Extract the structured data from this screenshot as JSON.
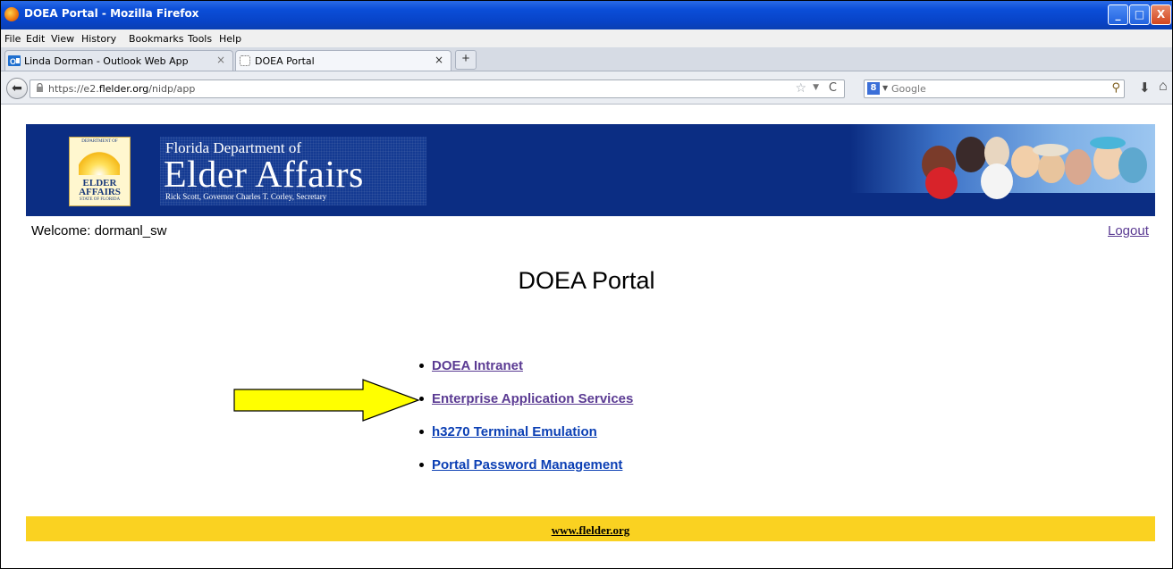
{
  "window": {
    "title": "DOEA Portal - Mozilla Firefox",
    "minimize": "_",
    "maximize": "□",
    "close": "X"
  },
  "menu": [
    "File",
    "Edit",
    "View",
    "History",
    "Bookmarks",
    "Tools",
    "Help"
  ],
  "tabs": [
    {
      "label": "Linda Dorman - Outlook Web App",
      "icon": "outlook-icon",
      "active": false
    },
    {
      "label": "DOEA Portal",
      "icon": "blank-page-icon",
      "active": true
    }
  ],
  "navbar": {
    "url_prefix": "https://e2.",
    "url_domain": "flelder.org",
    "url_path": "/nidp/app",
    "search_engine": "Google",
    "search_placeholder": "Google"
  },
  "banner": {
    "logo_top": "DEPARTMENT OF",
    "logo_main": "ELDER AFFAIRS",
    "logo_bottom": "STATE OF FLORIDA",
    "subtitle": "Florida Department of",
    "title": "Elder Affairs",
    "officials": "Rick Scott, Governor     Charles T. Corley, Secretary"
  },
  "page": {
    "welcome": "Welcome: dormanl_sw",
    "logout": "Logout",
    "title": "DOEA Portal",
    "links": [
      {
        "label": "DOEA Intranet",
        "visited": true
      },
      {
        "label": "Enterprise Application Services",
        "visited": true
      },
      {
        "label": "h3270 Terminal Emulation",
        "visited": false
      },
      {
        "label": "Portal Password Management",
        "visited": false
      }
    ],
    "footer": "www.flelder.org"
  },
  "colors": {
    "banner": "#0b2d83",
    "footer": "#fad221",
    "arrow": "#ffff00",
    "visited_link": "#5b3b93",
    "link": "#0b3fb4"
  }
}
